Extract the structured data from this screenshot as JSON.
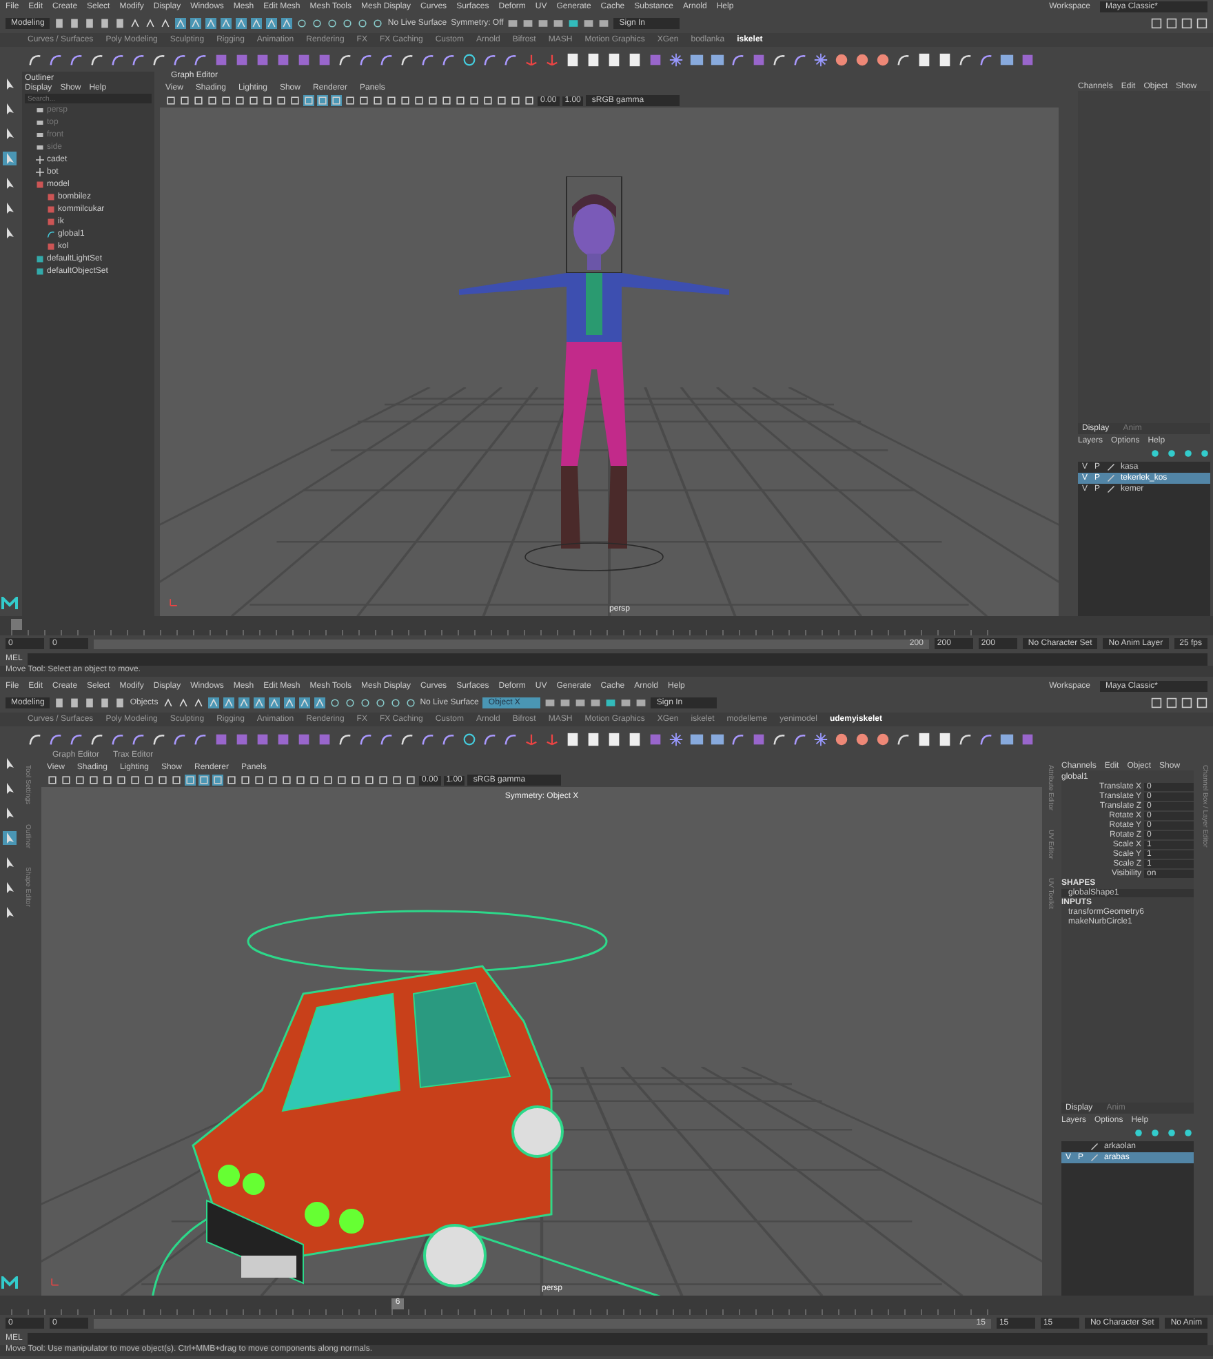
{
  "windows": [
    {
      "menu_bar": {
        "menus": [
          "File",
          "Edit",
          "Create",
          "Select",
          "Modify",
          "Display",
          "Windows",
          "Mesh",
          "Edit Mesh",
          "Mesh Tools",
          "Mesh Display",
          "Curves",
          "Surfaces",
          "Deform",
          "UV",
          "Generate",
          "Cache",
          "Substance",
          "Arnold",
          "Help"
        ],
        "workspace_label": "Workspace",
        "workspace": "Maya Classic*"
      },
      "kind": "character",
      "status_line": {
        "mode": "Modeling",
        "live_surface": "No Live Surface",
        "symmetry": "Symmetry: Off",
        "sign_in": "Sign In"
      },
      "shelf_tabs": [
        {
          "label": "Curves / Surfaces",
          "selected": false
        },
        {
          "label": "Poly Modeling",
          "selected": false
        },
        {
          "label": "Sculpting",
          "selected": false
        },
        {
          "label": "Rigging",
          "selected": false
        },
        {
          "label": "Animation",
          "selected": false
        },
        {
          "label": "Rendering",
          "selected": false
        },
        {
          "label": "FX",
          "selected": false
        },
        {
          "label": "FX Caching",
          "selected": false
        },
        {
          "label": "Custom",
          "selected": false
        },
        {
          "label": "Arnold",
          "selected": false
        },
        {
          "label": "Bifrost",
          "selected": false
        },
        {
          "label": "MASH",
          "selected": false
        },
        {
          "label": "Motion Graphics",
          "selected": false
        },
        {
          "label": "XGen",
          "selected": false
        },
        {
          "label": "bodlanka",
          "selected": false
        },
        {
          "label": "iskelet",
          "selected": true
        }
      ],
      "outliner": {
        "title": "Outliner",
        "menus": [
          "Display",
          "Show",
          "Help"
        ],
        "search_placeholder": "Search...",
        "items": [
          {
            "label": "persp",
            "kind": "camera",
            "dimmed": true
          },
          {
            "label": "top",
            "kind": "camera",
            "dimmed": true
          },
          {
            "label": "front",
            "kind": "camera",
            "dimmed": true
          },
          {
            "label": "side",
            "kind": "camera",
            "dimmed": true
          },
          {
            "label": "cadet",
            "kind": "locator",
            "dimmed": false
          },
          {
            "label": "bot",
            "kind": "locator",
            "dimmed": false
          },
          {
            "label": "model",
            "kind": "group",
            "dimmed": false,
            "children": [
              {
                "label": "bombilez",
                "kind": "group",
                "dimmed": false
              },
              {
                "label": "kommilcukar",
                "kind": "group",
                "dimmed": false
              },
              {
                "label": "ik",
                "kind": "group",
                "dimmed": false
              },
              {
                "label": "global1",
                "kind": "curve",
                "dimmed": false
              },
              {
                "label": "kol",
                "kind": "group",
                "dimmed": false
              }
            ]
          },
          {
            "label": "defaultLightSet",
            "kind": "set",
            "dimmed": false
          },
          {
            "label": "defaultObjectSet",
            "kind": "set",
            "dimmed": false
          }
        ]
      },
      "viewport": {
        "panel_tabs": [
          {
            "label": "Graph Editor",
            "selected": true
          }
        ],
        "menus": [
          "View",
          "Shading",
          "Lighting",
          "Show",
          "Renderer",
          "Panels"
        ],
        "exposure": "0.00",
        "gamma": "1.00",
        "color_space": "sRGB gamma",
        "camera": "persp"
      },
      "channel_box": {
        "menus": [
          "Channels",
          "Edit",
          "Object",
          "Show"
        ]
      },
      "layer_editor": {
        "tabs": [
          {
            "label": "Display",
            "selected": true
          },
          {
            "label": "Anim",
            "selected": false
          }
        ],
        "menus": [
          "Layers",
          "Options",
          "Help"
        ],
        "layers": [
          {
            "name": "kasa",
            "visible": "V",
            "playback": "P",
            "selected": false
          },
          {
            "name": "tekerlek_kos",
            "visible": "V",
            "playback": "P",
            "selected": true
          },
          {
            "name": "kemer",
            "visible": "V",
            "playback": "P",
            "selected": false
          }
        ]
      },
      "time_slider": {
        "level": 0
      },
      "range_slider": {
        "level": 1,
        "start": "0",
        "range_start": "0",
        "range_end": "200",
        "end": "200",
        "end_2": "200",
        "character_set": "No Character Set",
        "anim_layer": "No Anim Layer",
        "fps": "25 fps"
      },
      "command_line": {
        "language": "MEL"
      },
      "help_line": "Move Tool: Select an object to move."
    },
    {
      "menu_bar": {
        "menus": [
          "File",
          "Edit",
          "Create",
          "Select",
          "Modify",
          "Display",
          "Windows",
          "Mesh",
          "Edit Mesh",
          "Mesh Tools",
          "Mesh Display",
          "Curves",
          "Surfaces",
          "Deform",
          "UV",
          "Generate",
          "Cache",
          "Arnold",
          "Help"
        ],
        "workspace_label": "Workspace",
        "workspace": "Maya Classic*"
      },
      "kind": "car",
      "status_line": {
        "mode": "Modeling",
        "selection_mode": "Objects",
        "live_surface": "No Live Surface",
        "symmetry": "Object X",
        "sign_in": "Sign In"
      },
      "shelf_tabs": [
        {
          "label": "Curves / Surfaces",
          "selected": false
        },
        {
          "label": "Poly Modeling",
          "selected": false
        },
        {
          "label": "Sculpting",
          "selected": false
        },
        {
          "label": "Rigging",
          "selected": false
        },
        {
          "label": "Animation",
          "selected": false
        },
        {
          "label": "Rendering",
          "selected": false
        },
        {
          "label": "FX",
          "selected": false
        },
        {
          "label": "FX Caching",
          "selected": false
        },
        {
          "label": "Custom",
          "selected": false
        },
        {
          "label": "Arnold",
          "selected": false
        },
        {
          "label": "Bifrost",
          "selected": false
        },
        {
          "label": "MASH",
          "selected": false
        },
        {
          "label": "Motion Graphics",
          "selected": false
        },
        {
          "label": "XGen",
          "selected": false
        },
        {
          "label": "iskelet",
          "selected": false
        },
        {
          "label": "modelleme",
          "selected": false
        },
        {
          "label": "yenimodel",
          "selected": false
        },
        {
          "label": "udemyiskelet",
          "selected": true
        }
      ],
      "left_side_tabs": [
        "Tool Settings",
        "Outliner",
        "Shape Editor"
      ],
      "viewport": {
        "panel_tabs": [
          {
            "label": "Graph Editor",
            "selected": false
          },
          {
            "label": "Trax Editor",
            "selected": false
          }
        ],
        "menus": [
          "View",
          "Shading",
          "Lighting",
          "Show",
          "Renderer",
          "Panels"
        ],
        "exposure": "0.00",
        "gamma": "1.00",
        "color_space": "sRGB gamma",
        "heading": "Symmetry: Object X",
        "camera": "persp"
      },
      "right_side_tabs": [
        "Attribute Editor",
        "UV Editor",
        "UV Toolkit"
      ],
      "channel_box": {
        "menus": [
          "Channels",
          "Edit",
          "Object",
          "Show"
        ],
        "object": "global1",
        "attributes": [
          {
            "name": "Translate X",
            "value": "0"
          },
          {
            "name": "Translate Y",
            "value": "0"
          },
          {
            "name": "Translate Z",
            "value": "0"
          },
          {
            "name": "Rotate X",
            "value": "0"
          },
          {
            "name": "Rotate Y",
            "value": "0"
          },
          {
            "name": "Rotate Z",
            "value": "0"
          },
          {
            "name": "Scale X",
            "value": "1"
          },
          {
            "name": "Scale Y",
            "value": "1"
          },
          {
            "name": "Scale Z",
            "value": "1"
          },
          {
            "name": "Visibility",
            "value": "on"
          }
        ],
        "shapes_heading": "SHAPES",
        "shapes": [
          "globalShape1"
        ],
        "inputs_heading": "INPUTS",
        "inputs": [
          "transformGeometry6",
          "makeNurbCircle1"
        ]
      },
      "channel_side_tab": "Channel Box / Layer Editor",
      "layer_editor": {
        "tabs": [
          {
            "label": "Display",
            "selected": true
          },
          {
            "label": "Anim",
            "selected": false
          }
        ],
        "menus": [
          "Layers",
          "Options",
          "Help"
        ],
        "layers": [
          {
            "name": "arkaolan",
            "selected": false
          },
          {
            "name": "arabas",
            "visible": "V",
            "playback": "P",
            "selected": true
          }
        ]
      },
      "time_slider": {
        "current_frame": "6",
        "level": 0.33
      },
      "range_slider": {
        "level": 1,
        "start": "0",
        "range_start": "0",
        "range_end": "15",
        "end": "15",
        "end_2": "15",
        "character_set": "No Character Set",
        "anim_layer": "No Anim"
      },
      "command_line": {
        "language": "MEL"
      },
      "help_line": "Move Tool: Use manipulator to move object(s). Ctrl+MMB+drag to move components along normals."
    }
  ]
}
